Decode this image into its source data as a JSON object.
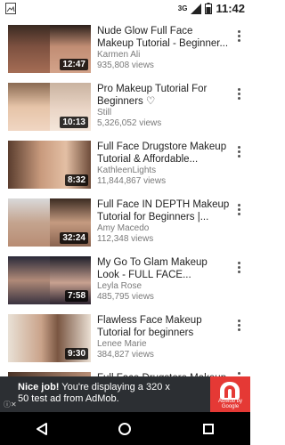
{
  "status_bar": {
    "network": "3G",
    "time": "11:42"
  },
  "videos": [
    {
      "title": "Nude Glow Full Face Makeup Tutorial - Beginner...",
      "channel": "Karmen Ali",
      "views": "935,808 views",
      "duration": "12:47"
    },
    {
      "title": "Pro Makeup Tutorial For Beginners ♡",
      "channel": "Still",
      "views": "5,326,052 views",
      "duration": "10:13"
    },
    {
      "title": "Full Face Drugstore Makeup Tutorial & Affordable...",
      "channel": "KathleenLights",
      "views": "11,844,867 views",
      "duration": "8:32"
    },
    {
      "title": "Full Face IN DEPTH Makeup Tutorial for Beginners |...",
      "channel": "Amy Macedo",
      "views": "112,348 views",
      "duration": "32:24"
    },
    {
      "title": "My Go To Glam Makeup Look - FULL FACE...",
      "channel": "Leyla Rose",
      "views": "485,795 views",
      "duration": "7:58"
    },
    {
      "title": "Flawless Face Makeup Tutorial for beginners",
      "channel": "Lenee Marie",
      "views": "384,827 views",
      "duration": "9:30"
    },
    {
      "title": "Full Face Drugstore Makeup",
      "channel": "",
      "views": "",
      "duration": ""
    }
  ],
  "ad_banner": {
    "text_bold": "Nice job!",
    "text_rest": " You're displaying a 320 x 50 test ad from AdMob.",
    "brand_caption": "AdMob by Google"
  }
}
